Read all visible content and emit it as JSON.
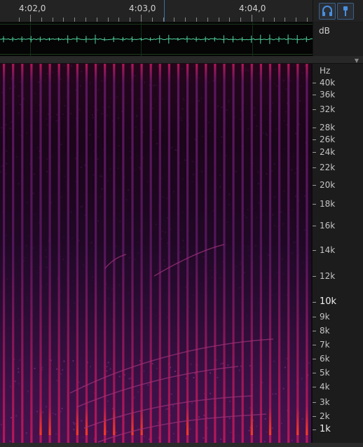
{
  "ruler": {
    "labels": [
      "4:02,0",
      "4:03,0",
      "4:04,0"
    ]
  },
  "toolbar": {
    "monitor_icon": "headphones-icon",
    "marker_icon": "pin-icon",
    "accent": "#3d7ad6"
  },
  "waveform": {
    "unit": "dB",
    "color": "#4fd6a0"
  },
  "spectrogram": {
    "unit": "Hz",
    "labels": [
      "40k",
      "36k",
      "32k",
      "28k",
      "26k",
      "24k",
      "22k",
      "20k",
      "18k",
      "16k",
      "14k",
      "12k",
      "10k",
      "9k",
      "8k",
      "7k",
      "6k",
      "5k",
      "4k",
      "3k",
      "2k",
      "1k"
    ],
    "emphasized": [
      "10k",
      "1k"
    ],
    "colors": {
      "low": "#1a0519",
      "mid": "#6a1a6e",
      "high": "#c2185b",
      "peak": "#ff3b1f"
    }
  }
}
